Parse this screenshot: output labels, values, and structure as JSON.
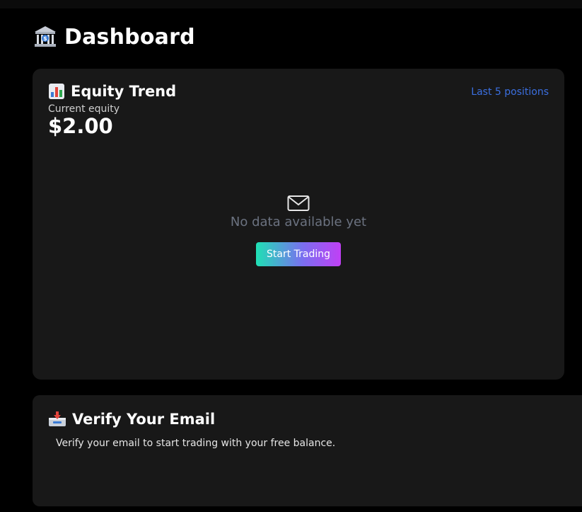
{
  "page": {
    "title": "Dashboard",
    "title_icon": "bank-icon"
  },
  "equity_card": {
    "title": "Equity Trend",
    "title_icon": "bar-chart-icon",
    "range_link": "Last 5 positions",
    "equity_label": "Current equity",
    "equity_value": "$2.00",
    "empty_icon": "mail-outline-icon",
    "empty_text": "No data available yet",
    "cta_label": "Start Trading"
  },
  "verify_card": {
    "title": "Verify Your Email",
    "title_icon": "inbox-tray-icon",
    "message": "Verify your email to start trading with your free balance."
  },
  "colors": {
    "background": "#000000",
    "card": "#181818",
    "link": "#3b6fe0",
    "muted_text": "#6b7280",
    "gradient_start": "#1fe0b4",
    "gradient_end": "#c040f5"
  }
}
